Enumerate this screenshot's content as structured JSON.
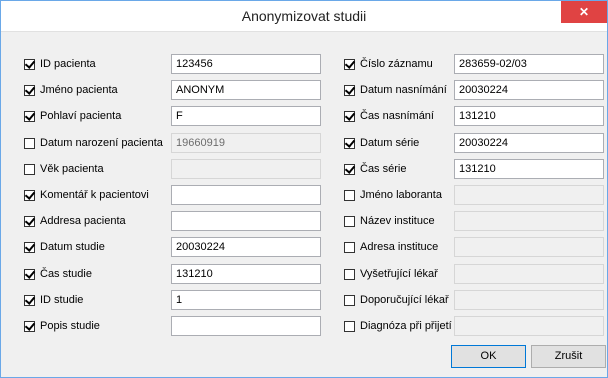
{
  "window": {
    "title": "Anonymizovat studii",
    "close_glyph": "✕"
  },
  "left_fields": [
    {
      "label": "ID pacienta",
      "checked": true,
      "enabled": true,
      "value": "123456"
    },
    {
      "label": "Jméno pacienta",
      "checked": true,
      "enabled": true,
      "value": "ANONYM"
    },
    {
      "label": "Pohlaví pacienta",
      "checked": true,
      "enabled": true,
      "value": "F"
    },
    {
      "label": "Datum narození pacienta",
      "checked": false,
      "enabled": false,
      "value": "19660919"
    },
    {
      "label": "Věk pacienta",
      "checked": false,
      "enabled": false,
      "value": ""
    },
    {
      "label": "Komentář k pacientovi",
      "checked": true,
      "enabled": true,
      "value": ""
    },
    {
      "label": "Addresa pacienta",
      "checked": true,
      "enabled": true,
      "value": ""
    },
    {
      "label": "Datum studie",
      "checked": true,
      "enabled": true,
      "value": "20030224"
    },
    {
      "label": "Čas studie",
      "checked": true,
      "enabled": true,
      "value": "131210"
    },
    {
      "label": "ID studie",
      "checked": true,
      "enabled": true,
      "value": "1"
    },
    {
      "label": "Popis studie",
      "checked": true,
      "enabled": true,
      "value": ""
    }
  ],
  "right_fields": [
    {
      "label": "Číslo záznamu",
      "checked": true,
      "enabled": true,
      "value": "283659-02/03"
    },
    {
      "label": "Datum nasnímání",
      "checked": true,
      "enabled": true,
      "value": "20030224"
    },
    {
      "label": "Čas nasnímání",
      "checked": true,
      "enabled": true,
      "value": "131210"
    },
    {
      "label": "Datum série",
      "checked": true,
      "enabled": true,
      "value": "20030224"
    },
    {
      "label": "Čas série",
      "checked": true,
      "enabled": true,
      "value": "131210"
    },
    {
      "label": "Jméno laboranta",
      "checked": false,
      "enabled": false,
      "value": ""
    },
    {
      "label": "Název instituce",
      "checked": false,
      "enabled": false,
      "value": ""
    },
    {
      "label": "Adresa instituce",
      "checked": false,
      "enabled": false,
      "value": ""
    },
    {
      "label": "Vyšetřující lékař",
      "checked": false,
      "enabled": false,
      "value": ""
    },
    {
      "label": "Doporučující lékař",
      "checked": false,
      "enabled": false,
      "value": ""
    },
    {
      "label": "Diagnóza při přijetí",
      "checked": false,
      "enabled": false,
      "value": ""
    }
  ],
  "buttons": {
    "ok": "OK",
    "cancel": "Zrušit"
  }
}
